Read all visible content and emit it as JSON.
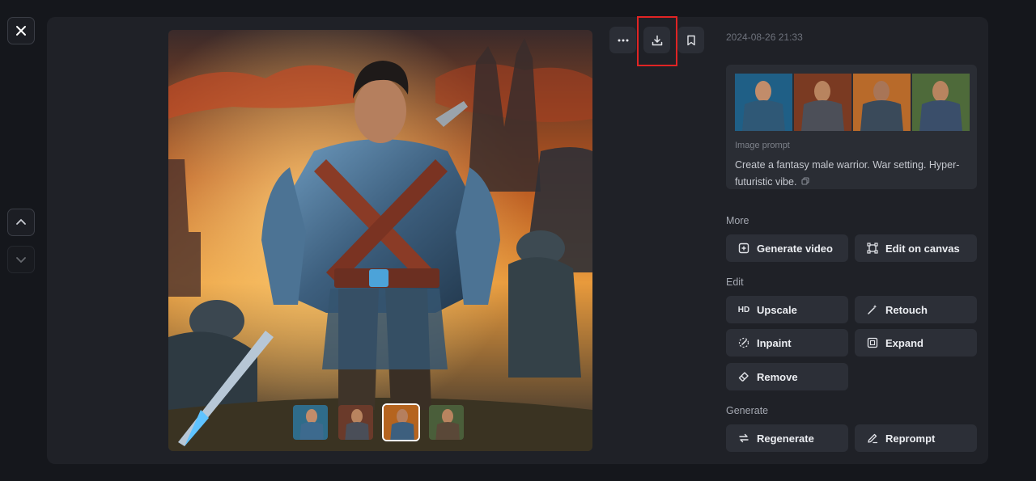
{
  "header": {
    "timestamp": "2024-08-26 21:33"
  },
  "toolbar": {
    "more_icon": "more-icon",
    "download_icon": "download-icon",
    "bookmark_icon": "bookmark-icon"
  },
  "viewer": {
    "thumbnails": [
      "variant-1",
      "variant-2",
      "variant-3",
      "variant-4"
    ],
    "active_thumbnail": 3
  },
  "prompt": {
    "label": "Image prompt",
    "text": "Create a fantasy male warrior. War setting. Hyper-futuristic vibe."
  },
  "sections": {
    "more": {
      "label": "More",
      "buttons": [
        {
          "label": "Generate video",
          "icon": "video-plus-icon"
        },
        {
          "label": "Edit on canvas",
          "icon": "canvas-icon"
        }
      ]
    },
    "edit": {
      "label": "Edit",
      "buttons": [
        {
          "label": "Upscale",
          "icon": "hd-icon",
          "icon_text": "HD"
        },
        {
          "label": "Retouch",
          "icon": "magic-wand-icon"
        },
        {
          "label": "Inpaint",
          "icon": "brush-icon"
        },
        {
          "label": "Expand",
          "icon": "expand-icon"
        },
        {
          "label": "Remove",
          "icon": "eraser-icon"
        }
      ]
    },
    "generate": {
      "label": "Generate",
      "buttons": [
        {
          "label": "Regenerate",
          "icon": "regenerate-icon"
        },
        {
          "label": "Reprompt",
          "icon": "pencil-icon"
        }
      ]
    }
  },
  "colors": {
    "background": "#15171c",
    "panel": "#1f2127",
    "button": "#2c2f37",
    "highlight": "#e02424"
  }
}
